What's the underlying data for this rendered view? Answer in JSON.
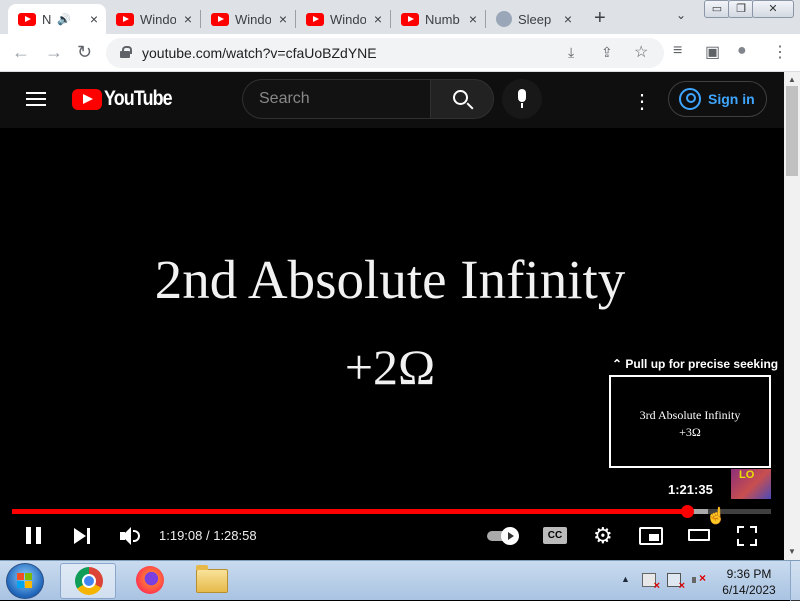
{
  "browser": {
    "tabs": [
      {
        "title": "N",
        "icon": "youtube-icon",
        "audio": "🔊",
        "active": true
      },
      {
        "title": "Windo",
        "icon": "youtube-icon"
      },
      {
        "title": "Windo",
        "icon": "youtube-icon"
      },
      {
        "title": "Windo",
        "icon": "youtube-icon"
      },
      {
        "title": "Numb",
        "icon": "youtube-icon"
      },
      {
        "title": "Sleep",
        "icon": "cat-icon"
      }
    ],
    "tab_close_glyph": "×",
    "new_tab_glyph": "+",
    "tab_search_glyph": "⌄",
    "window_controls": {
      "minimize": "▭",
      "maximize": "❐",
      "close": "✕"
    },
    "nav": {
      "back": "←",
      "forward": "→",
      "reload": "↻"
    },
    "url": "youtube.com/watch?v=cfaUoBZdYNE",
    "omnibox_icons": {
      "install": "⤓",
      "share": "⇪",
      "bookmark": "☆"
    },
    "toolbar_icons": {
      "reading_list": "≡",
      "side_panel": "▣",
      "profile": "●",
      "menu": "⋮"
    }
  },
  "youtube": {
    "logo_text": "YouTube",
    "search_placeholder": "Search",
    "more_glyph": "⋮",
    "sign_in_label": "Sign in"
  },
  "player": {
    "slide_title": "2nd Absolute Infinity",
    "slide_subtitle": "+2Ω",
    "seek_hint": "⌃ Pull up for precise seeking",
    "preview_line1": "3rd Absolute Infinity",
    "preview_line2": "+3Ω",
    "preview_time": "1:21:35",
    "thumbnail_label": "LO",
    "time_display": "1:19:08 / 1:28:58",
    "progress_played_fraction": 0.8895,
    "progress_hover_fraction": 0.9171,
    "cc_label": "CC",
    "settings_glyph": "⚙",
    "cursor_glyph": "☝"
  },
  "scrollbar": {
    "up": "▲",
    "down": "▼"
  },
  "taskbar": {
    "tray_arrow": "▲",
    "clock_time": "9:36 PM",
    "clock_date": "6/14/2023"
  }
}
